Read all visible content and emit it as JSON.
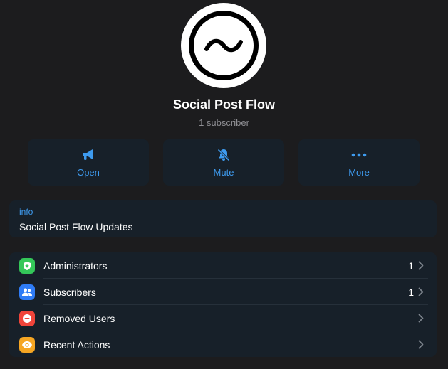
{
  "channel": {
    "name": "Social Post Flow",
    "subscribers_text": "1 subscriber"
  },
  "actions": [
    {
      "label": "Open",
      "icon": "megaphone-icon"
    },
    {
      "label": "Mute",
      "icon": "bell-slash-icon"
    },
    {
      "label": "More",
      "icon": "ellipsis-icon"
    }
  ],
  "info": {
    "label": "info",
    "value": "Social Post Flow Updates"
  },
  "manage": [
    {
      "label": "Administrators",
      "count": "1",
      "icon": "shield-icon",
      "color": "#34c759"
    },
    {
      "label": "Subscribers",
      "count": "1",
      "icon": "people-icon",
      "color": "#2f7cf6"
    },
    {
      "label": "Removed Users",
      "count": "",
      "icon": "minus-circle-icon",
      "color": "#f0443a"
    },
    {
      "label": "Recent Actions",
      "count": "",
      "icon": "eye-icon",
      "color": "#f6a623"
    }
  ],
  "colors": {
    "accent": "#3e9bef",
    "card": "#172029",
    "background": "#1c1c1e"
  }
}
